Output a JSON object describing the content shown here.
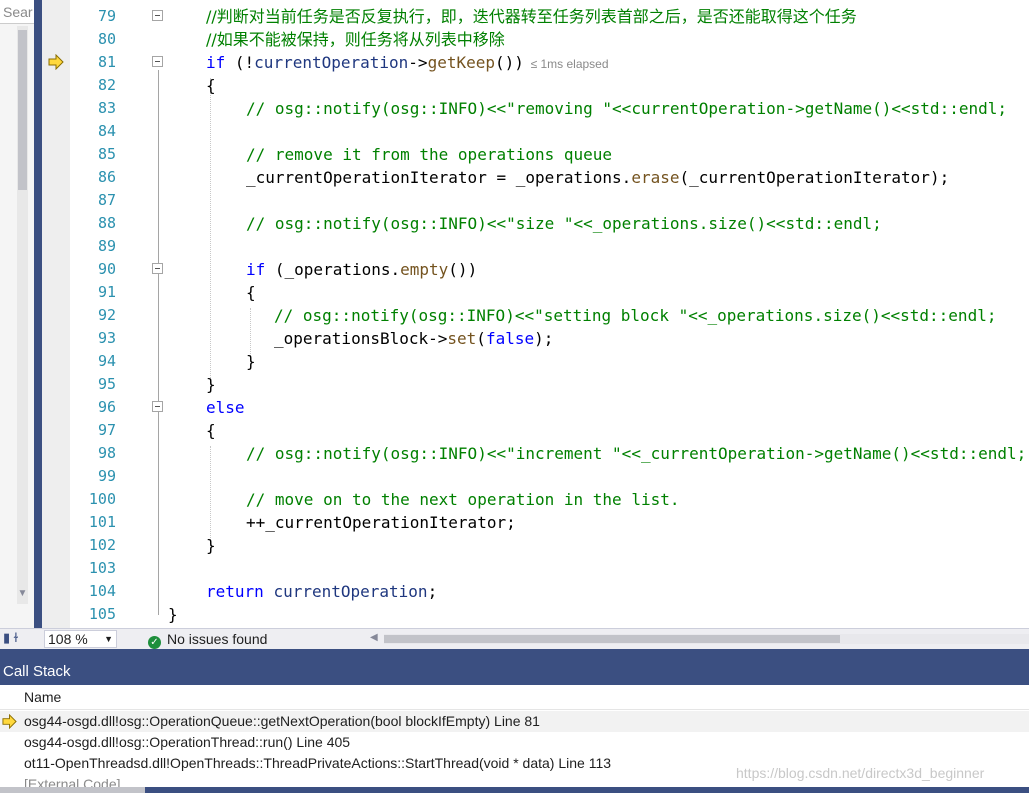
{
  "search": {
    "label": "Sear"
  },
  "editor": {
    "elapsed_hint": "≤ 1ms elapsed",
    "lines": [
      {
        "num": "79",
        "text": "//判断对当前任务是否反复执行，即，迭代器转至任务列表首部之后，是否还能取得这个任务"
      },
      {
        "num": "80",
        "text": "//如果不能被保持，则任务将从列表中移除"
      },
      {
        "num": "81",
        "text": "if (!currentOperation->getKeep())"
      },
      {
        "num": "82",
        "text": "{"
      },
      {
        "num": "83",
        "text": "// osg::notify(osg::INFO)<<\"removing \"<<currentOperation->getName()<<std::endl;"
      },
      {
        "num": "84",
        "text": ""
      },
      {
        "num": "85",
        "text": "// remove it from the operations queue"
      },
      {
        "num": "86",
        "text": "_currentOperationIterator = _operations.erase(_currentOperationIterator);"
      },
      {
        "num": "87",
        "text": ""
      },
      {
        "num": "88",
        "text": "// osg::notify(osg::INFO)<<\"size \"<<_operations.size()<<std::endl;"
      },
      {
        "num": "89",
        "text": ""
      },
      {
        "num": "90",
        "text": "if (_operations.empty())"
      },
      {
        "num": "91",
        "text": "{"
      },
      {
        "num": "92",
        "text": "// osg::notify(osg::INFO)<<\"setting block \"<<_operations.size()<<std::endl;"
      },
      {
        "num": "93",
        "text": "_operationsBlock->set(false);"
      },
      {
        "num": "94",
        "text": "}"
      },
      {
        "num": "95",
        "text": "}"
      },
      {
        "num": "96",
        "text": "else"
      },
      {
        "num": "97",
        "text": "{"
      },
      {
        "num": "98",
        "text": "// osg::notify(osg::INFO)<<\"increment \"<<_currentOperation->getName()<<std::endl;"
      },
      {
        "num": "99",
        "text": ""
      },
      {
        "num": "100",
        "text": "// move on to the next operation in the list."
      },
      {
        "num": "101",
        "text": "++_currentOperationIterator;"
      },
      {
        "num": "102",
        "text": "}"
      },
      {
        "num": "103",
        "text": ""
      },
      {
        "num": "104",
        "text": "return currentOperation;"
      },
      {
        "num": "105",
        "text": "}"
      }
    ]
  },
  "status": {
    "zoom": "108 %",
    "issues": "No issues found"
  },
  "callstack": {
    "title": "Call Stack",
    "column_name": "Name",
    "rows": [
      {
        "text": "osg44-osgd.dll!osg::OperationQueue::getNextOperation(bool blockIfEmpty) Line 81",
        "current": true
      },
      {
        "text": "osg44-osgd.dll!osg::OperationThread::run() Line 405",
        "current": false
      },
      {
        "text": "ot11-OpenThreadsd.dll!OpenThreads::ThreadPrivateActions::StartThread(void * data) Line 113",
        "current": false
      },
      {
        "text": "[External Code]",
        "current": false
      }
    ]
  },
  "watermark": "https://blog.csdn.net/directx3d_beginner",
  "colors": {
    "comment": "#008000",
    "keyword": "#0000ff",
    "line_number": "#2b91af",
    "accent": "#3b4f81"
  }
}
